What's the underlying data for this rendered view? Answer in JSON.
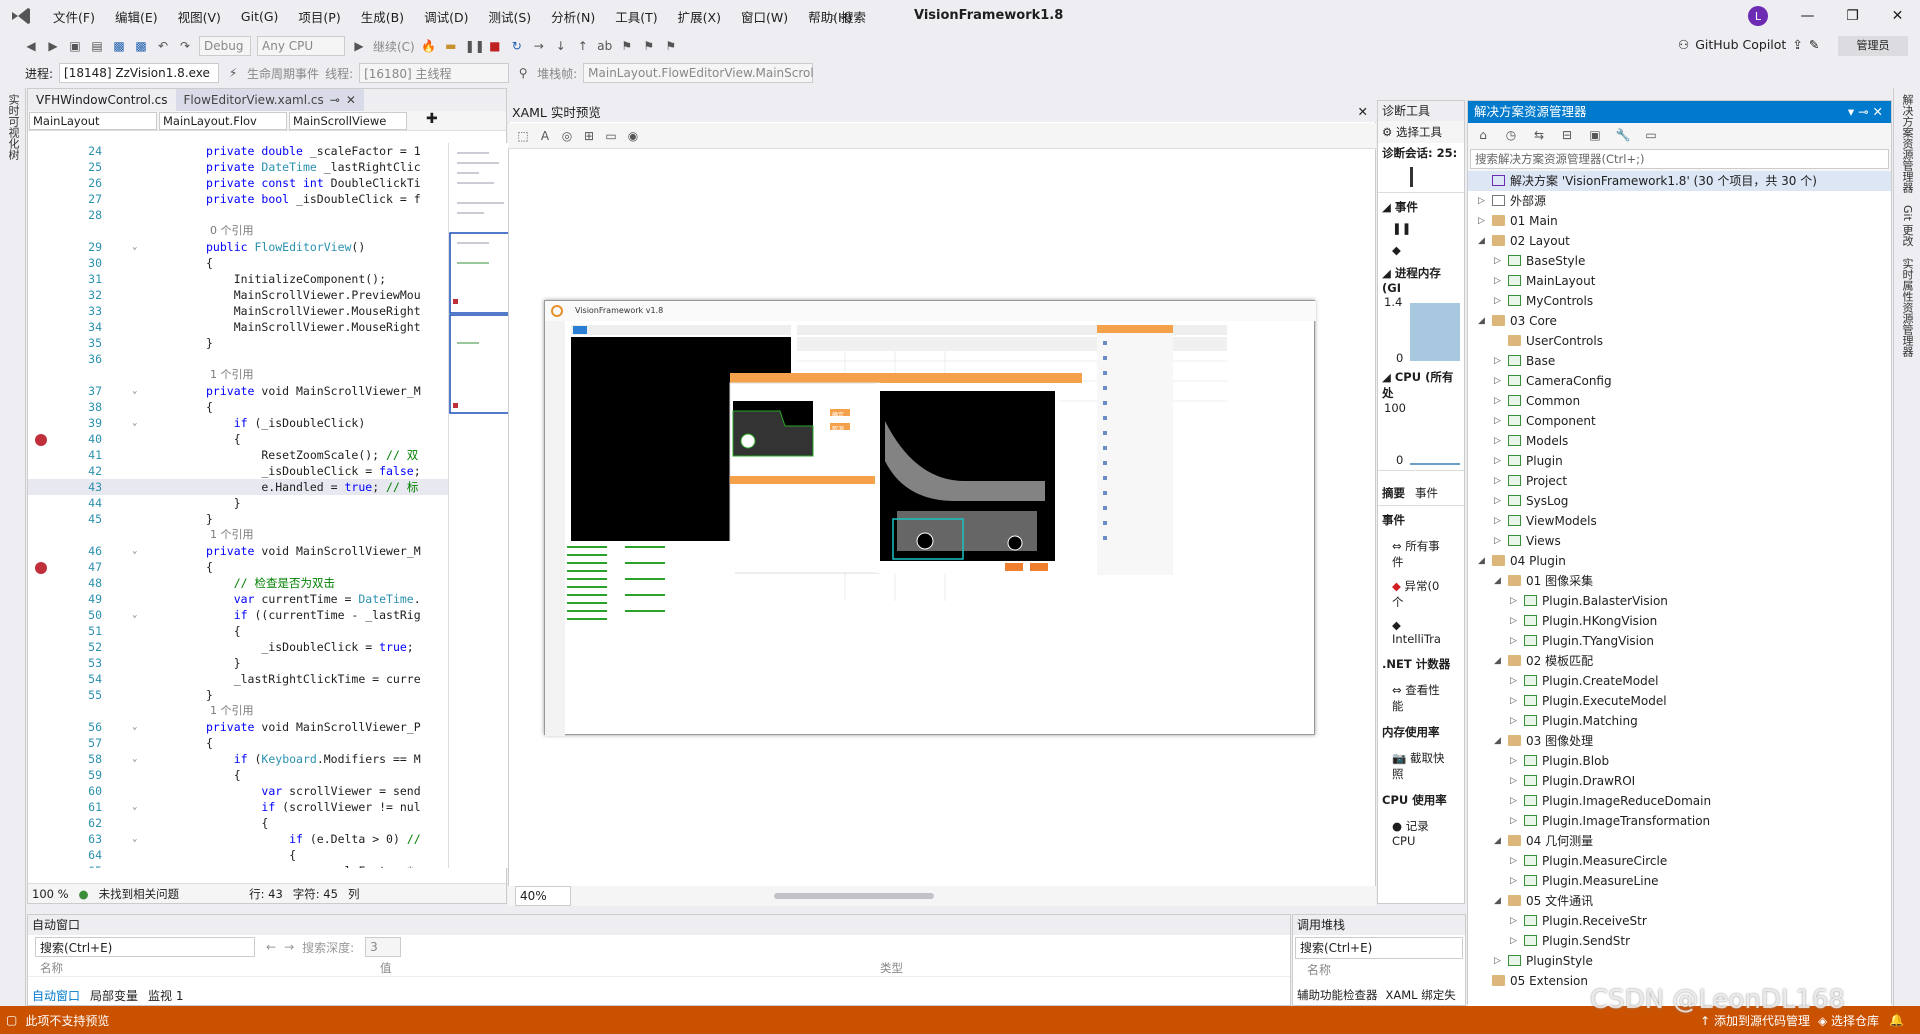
{
  "menubar": {
    "items": [
      "文件(F)",
      "编辑(E)",
      "视图(V)",
      "Git(G)",
      "项目(P)",
      "生成(B)",
      "调试(D)",
      "测试(S)",
      "分析(N)",
      "工具(T)",
      "扩展(X)",
      "窗口(W)",
      "帮助(H)"
    ],
    "search_label": "搜索",
    "app_title": "VisionFramework1.8",
    "avatar_initial": "L",
    "window_controls": [
      "—",
      "❐",
      "✕"
    ]
  },
  "toolbar": {
    "config": "Debug",
    "platform": "Any CPU",
    "continue_label": "继续(C)",
    "copilot_label": "GitHub Copilot",
    "admin_label": "管理员"
  },
  "debug_bar": {
    "process_label": "进程:",
    "process_value": "[18148] ZzVision1.8.exe",
    "lifecycle_label": "生命周期事件",
    "thread_label": "线程:",
    "thread_value": "[16180] 主线程",
    "stack_label": "堆栈帧:",
    "stack_value": "MainLayout.FlowEditorView.MainScrol"
  },
  "left_strip": {
    "label": "实时可视化树"
  },
  "editor": {
    "tabs": [
      {
        "label": "VFHWindowControl.cs"
      },
      {
        "label": "FlowEditorView.xaml.cs"
      }
    ],
    "nav": [
      "MainLayout",
      "MainLayout.Flov",
      "MainScrollViewe"
    ],
    "lines": [
      {
        "n": "24",
        "t": "private double _scaleFactor = 1",
        "k": "field"
      },
      {
        "n": "25",
        "t": "private DateTime _lastRightClic",
        "k": "field"
      },
      {
        "n": "26",
        "t": "private const int DoubleClickTi",
        "k": "field"
      },
      {
        "n": "27",
        "t": "private bool _isDoubleClick = f",
        "k": "field"
      },
      {
        "n": "28",
        "t": "",
        "k": ""
      },
      {
        "n": "",
        "t": "0 个引用",
        "k": "ref"
      },
      {
        "n": "29",
        "t": "public FlowEditorView()",
        "k": "sig"
      },
      {
        "n": "30",
        "t": "{",
        "k": ""
      },
      {
        "n": "31",
        "t": "    InitializeComponent();",
        "k": ""
      },
      {
        "n": "32",
        "t": "    MainScrollViewer.PreviewMou",
        "k": ""
      },
      {
        "n": "33",
        "t": "    MainScrollViewer.MouseRight",
        "k": ""
      },
      {
        "n": "34",
        "t": "    MainScrollViewer.MouseRight",
        "k": ""
      },
      {
        "n": "35",
        "t": "}",
        "k": ""
      },
      {
        "n": "36",
        "t": "",
        "k": ""
      },
      {
        "n": "",
        "t": "1 个引用",
        "k": "ref"
      },
      {
        "n": "37",
        "t": "private void MainScrollViewer_M",
        "k": "sig"
      },
      {
        "n": "38",
        "t": "{",
        "k": ""
      },
      {
        "n": "39",
        "t": "    if (_isDoubleClick)",
        "k": "if"
      },
      {
        "n": "40",
        "t": "    {",
        "k": "bp"
      },
      {
        "n": "41",
        "t": "        ResetZoomScale(); // 双",
        "k": "cm"
      },
      {
        "n": "42",
        "t": "        _isDoubleClick = false;",
        "k": ""
      },
      {
        "n": "43",
        "t": "        e.Handled = true; // 标",
        "k": "cur"
      },
      {
        "n": "44",
        "t": "    }",
        "k": ""
      },
      {
        "n": "45",
        "t": "}",
        "k": ""
      },
      {
        "n": "",
        "t": "1 个引用",
        "k": "ref"
      },
      {
        "n": "46",
        "t": "private void MainScrollViewer_M",
        "k": "sig"
      },
      {
        "n": "47",
        "t": "{",
        "k": "bp"
      },
      {
        "n": "48",
        "t": "    // 检查是否为双击",
        "k": "comment"
      },
      {
        "n": "49",
        "t": "    var currentTime = DateTime.",
        "k": ""
      },
      {
        "n": "50",
        "t": "    if ((currentTime - _lastRig",
        "k": "if"
      },
      {
        "n": "51",
        "t": "    {",
        "k": ""
      },
      {
        "n": "52",
        "t": "        _isDoubleClick = true;",
        "k": ""
      },
      {
        "n": "53",
        "t": "    }",
        "k": ""
      },
      {
        "n": "54",
        "t": "    _lastRightClickTime = curre",
        "k": ""
      },
      {
        "n": "55",
        "t": "}",
        "k": ""
      },
      {
        "n": "",
        "t": "1 个引用",
        "k": "ref"
      },
      {
        "n": "56",
        "t": "private void MainScrollViewer_P",
        "k": "sig"
      },
      {
        "n": "57",
        "t": "{",
        "k": ""
      },
      {
        "n": "58",
        "t": "    if (Keyboard.Modifiers == M",
        "k": "if"
      },
      {
        "n": "59",
        "t": "    {",
        "k": ""
      },
      {
        "n": "60",
        "t": "        var scrollViewer = send",
        "k": "var"
      },
      {
        "n": "61",
        "t": "        if (scrollViewer != nul",
        "k": "if"
      },
      {
        "n": "62",
        "t": "        {",
        "k": ""
      },
      {
        "n": "63",
        "t": "            if (e.Delta > 0) //",
        "k": "if"
      },
      {
        "n": "64",
        "t": "            {",
        "k": ""
      },
      {
        "n": "65",
        "t": "                _scaleFactor *=",
        "k": ""
      },
      {
        "n": "66",
        "t": "            }",
        "k": ""
      }
    ],
    "status": {
      "zoom": "100 %",
      "issues": "未找到相关问题",
      "line": "行: 43",
      "char": "字符: 45",
      "col": "列"
    }
  },
  "xaml": {
    "title": "XAML 实时预览",
    "zoom": "40%",
    "preview": {
      "window_title": "VisionFramework v1.8",
      "dialog_btn_ok": "确定",
      "dialog_btn_cancel": "取消"
    }
  },
  "diag": {
    "title": "诊断工具",
    "select_tool": "选择工具",
    "session": "诊断会话: 25:",
    "events": "事件",
    "process_mem": "进程内存 (GI",
    "mem_top": "1.4",
    "mem_bottom": "0",
    "cpu": "CPU (所有处",
    "cpu_top": "100",
    "cpu_bottom": "0",
    "tabs": [
      "摘要",
      "事件"
    ],
    "events2": "事件",
    "all_events": "所有事件",
    "exceptions": "异常(0 个",
    "intellitrace": "IntelliTra",
    "net_counters": ".NET 计数器",
    "view_perf": "查看性能",
    "mem_usage": "内存使用率",
    "snapshot": "截取快照",
    "cpu_usage": "CPU 使用率",
    "record_cpu": "记录 CPU"
  },
  "solution": {
    "title": "解决方案资源管理器",
    "search_placeholder": "搜索解决方案资源管理器(Ctrl+;)",
    "items": [
      {
        "label": "解决方案 'VisionFramework1.8' (30 个项目，共 30 个)",
        "lvl": 0,
        "icon": "sln",
        "arrow": ""
      },
      {
        "label": "外部源",
        "lvl": 0,
        "icon": "ext",
        "arrow": "▷"
      },
      {
        "label": "01 Main",
        "lvl": 0,
        "icon": "folder",
        "arrow": "▷"
      },
      {
        "label": "02 Layout",
        "lvl": 0,
        "icon": "folder",
        "arrow": "◢"
      },
      {
        "label": "BaseStyle",
        "lvl": 1,
        "icon": "proj",
        "arrow": "▷"
      },
      {
        "label": "MainLayout",
        "lvl": 1,
        "icon": "proj",
        "arrow": "▷"
      },
      {
        "label": "MyControls",
        "lvl": 1,
        "icon": "proj",
        "arrow": "▷"
      },
      {
        "label": "03 Core",
        "lvl": 0,
        "icon": "folder",
        "arrow": "◢"
      },
      {
        "label": "UserControls",
        "lvl": 1,
        "icon": "folder",
        "arrow": ""
      },
      {
        "label": "Base",
        "lvl": 1,
        "icon": "proj",
        "arrow": "▷"
      },
      {
        "label": "CameraConfig",
        "lvl": 1,
        "icon": "proj",
        "arrow": "▷"
      },
      {
        "label": "Common",
        "lvl": 1,
        "icon": "proj",
        "arrow": "▷"
      },
      {
        "label": "Component",
        "lvl": 1,
        "icon": "proj",
        "arrow": "▷"
      },
      {
        "label": "Models",
        "lvl": 1,
        "icon": "proj",
        "arrow": "▷"
      },
      {
        "label": "Plugin",
        "lvl": 1,
        "icon": "proj",
        "arrow": "▷"
      },
      {
        "label": "Project",
        "lvl": 1,
        "icon": "proj",
        "arrow": "▷"
      },
      {
        "label": "SysLog",
        "lvl": 1,
        "icon": "proj",
        "arrow": "▷"
      },
      {
        "label": "ViewModels",
        "lvl": 1,
        "icon": "proj",
        "arrow": "▷"
      },
      {
        "label": "Views",
        "lvl": 1,
        "icon": "proj",
        "arrow": "▷"
      },
      {
        "label": "04 Plugin",
        "lvl": 0,
        "icon": "folder",
        "arrow": "◢"
      },
      {
        "label": "01 图像采集",
        "lvl": 1,
        "icon": "folder",
        "arrow": "◢"
      },
      {
        "label": "Plugin.BalasterVision",
        "lvl": 2,
        "icon": "proj",
        "arrow": "▷"
      },
      {
        "label": "Plugin.HKongVision",
        "lvl": 2,
        "icon": "proj",
        "arrow": "▷"
      },
      {
        "label": "Plugin.TYangVision",
        "lvl": 2,
        "icon": "proj",
        "arrow": "▷"
      },
      {
        "label": "02 模板匹配",
        "lvl": 1,
        "icon": "folder",
        "arrow": "◢"
      },
      {
        "label": "Plugin.CreateModel",
        "lvl": 2,
        "icon": "proj",
        "arrow": "▷"
      },
      {
        "label": "Plugin.ExecuteModel",
        "lvl": 2,
        "icon": "proj",
        "arrow": "▷"
      },
      {
        "label": "Plugin.Matching",
        "lvl": 2,
        "icon": "proj",
        "arrow": "▷"
      },
      {
        "label": "03 图像处理",
        "lvl": 1,
        "icon": "folder",
        "arrow": "◢"
      },
      {
        "label": "Plugin.Blob",
        "lvl": 2,
        "icon": "proj",
        "arrow": "▷"
      },
      {
        "label": "Plugin.DrawROI",
        "lvl": 2,
        "icon": "proj",
        "arrow": "▷"
      },
      {
        "label": "Plugin.ImageReduceDomain",
        "lvl": 2,
        "icon": "proj",
        "arrow": "▷"
      },
      {
        "label": "Plugin.ImageTransformation",
        "lvl": 2,
        "icon": "proj",
        "arrow": "▷"
      },
      {
        "label": "04 几何测量",
        "lvl": 1,
        "icon": "folder",
        "arrow": "◢"
      },
      {
        "label": "Plugin.MeasureCircle",
        "lvl": 2,
        "icon": "proj",
        "arrow": "▷"
      },
      {
        "label": "Plugin.MeasureLine",
        "lvl": 2,
        "icon": "proj",
        "arrow": "▷"
      },
      {
        "label": "05 文件通讯",
        "lvl": 1,
        "icon": "folder",
        "arrow": "◢"
      },
      {
        "label": "Plugin.ReceiveStr",
        "lvl": 2,
        "icon": "proj",
        "arrow": "▷"
      },
      {
        "label": "Plugin.SendStr",
        "lvl": 2,
        "icon": "proj",
        "arrow": "▷"
      },
      {
        "label": "PluginStyle",
        "lvl": 1,
        "icon": "proj",
        "arrow": "▷"
      },
      {
        "label": "05 Extension",
        "lvl": 0,
        "icon": "folder",
        "arrow": ""
      }
    ]
  },
  "right_strip": {
    "labels": [
      "解决方案资源管理器",
      "Git 更改",
      "实时属性资源管理器"
    ]
  },
  "auto_window": {
    "title": "自动窗口",
    "search": "搜索(Ctrl+E)",
    "depth": "搜索深度:",
    "depth_value": "3",
    "cols": [
      "名称",
      "值",
      "类型"
    ],
    "tabs": [
      "自动窗口",
      "局部变量",
      "监视 1"
    ]
  },
  "call_stack": {
    "title": "调用堆栈",
    "search": "搜索(Ctrl+E)",
    "col": "名称",
    "tabs": [
      "辅助功能检查器",
      "XAML 绑定失"
    ]
  },
  "statusbar": {
    "message": "此项不支持预览",
    "source_control": "添加到源代码管理",
    "select_repo": "选择仓库",
    "watermark": "CSDN @LeonDL168"
  }
}
